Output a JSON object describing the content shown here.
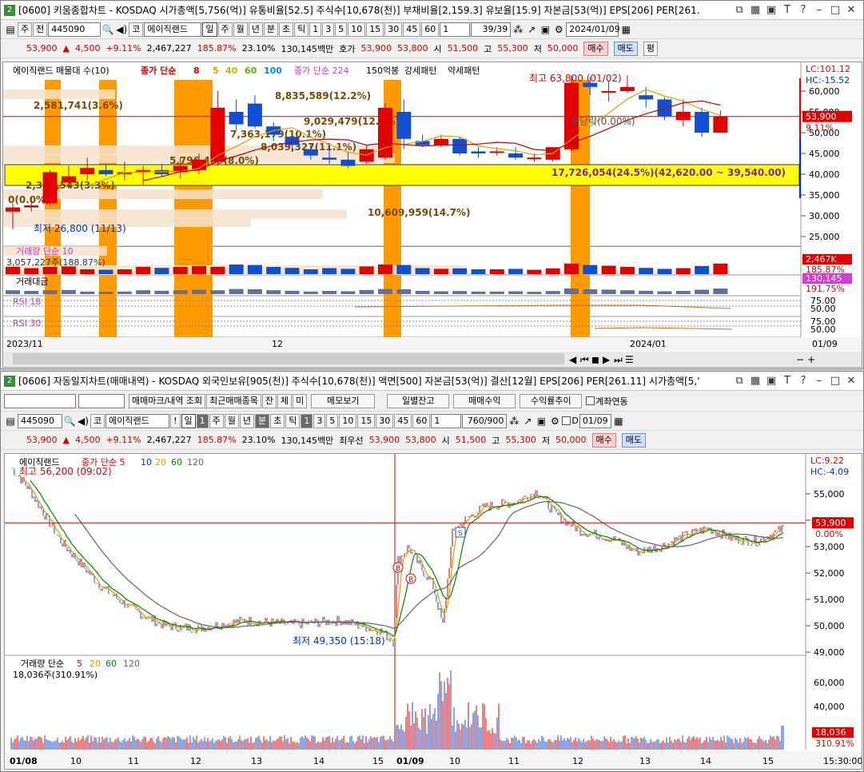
{
  "w1": {
    "num": "2",
    "title": "[0600] 키움종합차트 - KOSDAQ 시가총액[5,756(억)] 유통비율[52.5] 주식수[10,678(천)] 부채비율[2,159.3] 유보율[15.9] 자본금[53(억)] EPS[206] PER[261.",
    "toolbar": {
      "type": "주",
      "prev": "전",
      "code": "445090",
      "market": "코",
      "name": "에이직랜드",
      "periods": [
        "일",
        "주",
        "월",
        "년",
        "분",
        "초",
        "틱"
      ],
      "nums": [
        "1",
        "3",
        "5",
        "10",
        "15",
        "30",
        "45",
        "60"
      ],
      "unit": "1",
      "count": "39/39",
      "date": "2024/01/09"
    },
    "quote": {
      "price": "53,900",
      "arrow": "▲",
      "change": "4,500",
      "pct": "+9.11%",
      "volume": "2,467,227",
      "ratio": "185.87%",
      "turn": "23.10%",
      "amount": "130,145백만",
      "hoga": "호가",
      "ask": "53,900",
      "bid": "53,800",
      "open_l": "시",
      "open": "51,500",
      "high_l": "고",
      "high": "55,300",
      "low_l": "저",
      "low": "50,000",
      "buy": "매수",
      "sell": "매도",
      "eval": "평"
    },
    "legend": {
      "name": "에이직랜드 매물대 수(10)",
      "ma": "종가 단순",
      "p1": "8",
      "p2": "5",
      "p3": "40",
      "p4": "60",
      "p5": "100",
      "ma2": "종가 단순 224",
      "s": "150억봉",
      "u": "강세패턴",
      "d": "약세패턴"
    },
    "corner": {
      "lc": "LC:101.12",
      "hc": "HC:-15.52"
    },
    "yticks": [
      "60,000",
      "55,000",
      "50,000",
      "45,000",
      "40,000",
      "35,000",
      "30,000",
      "25,000"
    ],
    "lbl": {
      "hi": "최고 63,800 (01/02)",
      "lo": "최저 26,800 (11/13)",
      "div": "배당락(0.00%)",
      "pricetag": "53,900",
      "pcttag": "9.11%",
      "zero": "0(0.0%)"
    },
    "profile": [
      "2,581,741(3.6%)",
      "8,835,589(12.2%)",
      "9,029,479(12.5%)",
      "7,363,179(10.1%)",
      "8,039,327(11.1%)",
      "5,796,409(8.0%)",
      "17,726,054(24.5%)(42,620.00 ~ 39,540.00)",
      "2,397,543(3.3%)",
      "10,609,959(14.7%)"
    ],
    "vol": {
      "label": "거래량 단순 10",
      "v": "3,057,227주(188.87%)",
      "tag": "2,467K",
      "tag2": "185.87%"
    },
    "amt": {
      "label": "거래대금",
      "tag": "130,145",
      "tag2": "191.75%"
    },
    "rsi": {
      "a": "RSI 18",
      "b": "RSI 30",
      "t1": "75.00",
      "t2": "50.00",
      "t3": "75.00",
      "t4": "50.00"
    },
    "xaxis": [
      "2023/11",
      "12",
      "2024/01",
      "01/09"
    ]
  },
  "w2": {
    "num": "2",
    "title": "[0606] 자동일지차트(매매내역) - KOSDAQ 외국인보유[905(천)] 주식수[10,678(천)] 액면[500] 자본금[53(억)] 결산[12월] EPS[206] PER[261.11] 시가총액[5,'",
    "tb1": {
      "b1": "매매마크/내역 조회",
      "b2": "최근매매종목",
      "b3": "잔",
      "b4": "체",
      "b5": "미",
      "b6": "메모보기",
      "b7": "일별잔고",
      "b8": "매매수익",
      "b9": "수익률추이",
      "b10": "계좌연동"
    },
    "tb2": {
      "code": "445090",
      "market": "코",
      "name": "에이직랜드",
      "bang": "!",
      "day": "일",
      "n": "1",
      "periods": [
        "주",
        "월",
        "년",
        "분",
        "초",
        "틱"
      ],
      "nums": [
        "1",
        "3",
        "5",
        "10",
        "15",
        "30",
        "45",
        "60"
      ],
      "unit": "1",
      "count": "760/900",
      "d": "D",
      "date": "01/09"
    },
    "quote": {
      "price": "53,900",
      "arrow": "▲",
      "change": "4,500",
      "pct": "+9.11%",
      "volume": "2,467,227",
      "ratio": "185.87%",
      "turn": "23.10%",
      "amount": "130,145백만",
      "hoga": "최우선",
      "ask": "53,900",
      "bid": "53,800",
      "open_l": "시",
      "open": "51,500",
      "high_l": "고",
      "high": "55,300",
      "low_l": "저",
      "low": "50,000",
      "buy": "매수",
      "sell": "매도"
    },
    "legend": {
      "name": "에이직랜드",
      "ma": "종가 단순 5",
      "p2": "10",
      "p3": "20",
      "p4": "60",
      "p5": "120"
    },
    "corner": {
      "lc": "LC:9.22",
      "hc": "HC:-4.09"
    },
    "yticks": [
      "55,000",
      "54,000",
      "53,000",
      "52,000",
      "51,000",
      "50,000",
      "49,000"
    ],
    "lbl": {
      "hi": "최고 56,200 (09:02)",
      "lo": "최저 49,350 (15:18)",
      "pricetag": "53,900",
      "pcttag": "0.00%",
      "b": "B",
      "s": "S"
    },
    "vol": {
      "label": "거래량 단순",
      "p1": "5",
      "p2": "20",
      "p3": "60",
      "p4": "120",
      "v": "18,036주(310.91%)",
      "tag": "18,036",
      "tag2": "310.91%",
      "yt": [
        "60,000",
        "40,000",
        "20,000"
      ]
    },
    "xaxis": [
      "01/08",
      "10",
      "11",
      "12",
      "13",
      "14",
      "15",
      "01/09",
      "10",
      "11",
      "12",
      "13",
      "14",
      "15",
      "15:30:00"
    ]
  }
}
